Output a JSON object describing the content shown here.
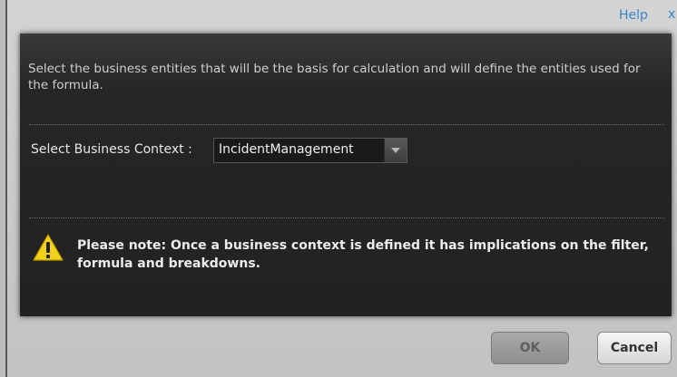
{
  "header": {
    "help_label": "Help",
    "close_glyph": "x"
  },
  "dialog": {
    "description": "Select the business entities that will be the basis for calculation and will define the entities used for the formula.",
    "context_label": "Select Business Context :",
    "context_select": {
      "value": "IncidentManagement",
      "icon": "chevron-down-icon"
    },
    "note": {
      "icon": "warning-icon",
      "text": "Please note: Once a business context is defined it has implications on the filter, formula and breakdowns."
    }
  },
  "footer": {
    "ok_label": "OK",
    "cancel_label": "Cancel"
  },
  "colors": {
    "panel_bg": "#262626",
    "link": "#3a86c8",
    "warning_yellow": "#f2d21b"
  }
}
